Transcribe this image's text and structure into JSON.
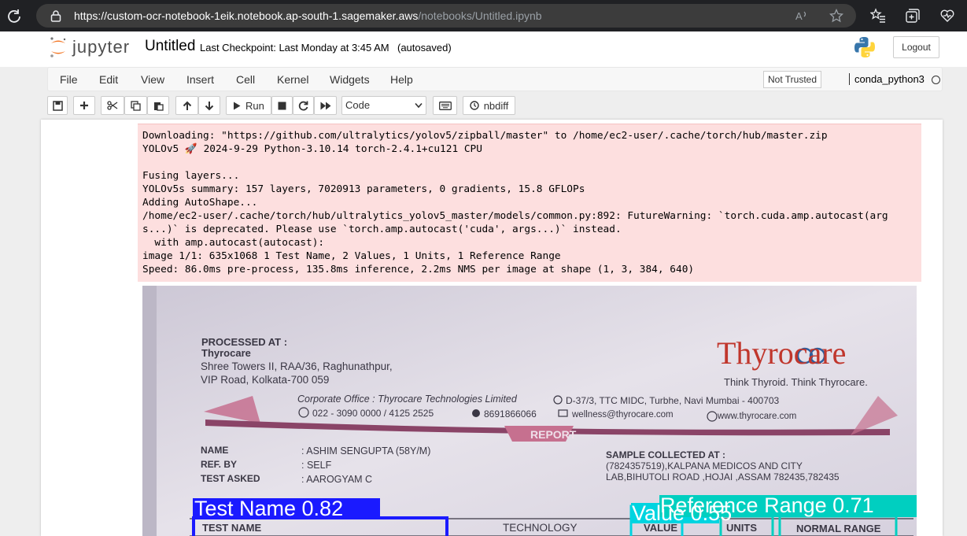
{
  "browser": {
    "url_host": "https://custom-ocr-notebook-1eik.notebook.ap-south-1.sagemaker.aws",
    "url_path": "/notebooks/Untitled.ipynb"
  },
  "header": {
    "wordmark": "jupyter",
    "notebook_title": "Untitled",
    "checkpoint": "Last Checkpoint: Last Monday at 3:45 AM",
    "autosaved": "(autosaved)",
    "logout_label": "Logout"
  },
  "menubar": {
    "items": [
      "File",
      "Edit",
      "View",
      "Insert",
      "Cell",
      "Kernel",
      "Widgets",
      "Help"
    ],
    "trust_status": "Not Trusted",
    "kernel": "conda_python3"
  },
  "toolbar": {
    "run_label": "Run",
    "cell_type": "Code",
    "nbdiff_label": "nbdiff"
  },
  "output": {
    "stderr_lines": [
      "Downloading: \"https://github.com/ultralytics/yolov5/zipball/master\" to /home/ec2-user/.cache/torch/hub/master.zip",
      "YOLOv5 🚀 2024-9-29 Python-3.10.14 torch-2.4.1+cu121 CPU",
      "",
      "Fusing layers...",
      "YOLOv5s summary: 157 layers, 7020913 parameters, 0 gradients, 15.8 GFLOPs",
      "Adding AutoShape...",
      "/home/ec2-user/.cache/torch/hub/ultralytics_yolov5_master/models/common.py:892: FutureWarning: `torch.cuda.amp.autocast(arg",
      "s...)` is deprecated. Please use `torch.amp.autocast('cuda', args...)` instead.",
      "  with amp.autocast(autocast):",
      "image 1/1: 635x1068 1 Test Name, 2 Values, 1 Units, 1 Reference Range",
      "Speed: 86.0ms pre-process, 135.8ms inference, 2.2ms NMS per image at shape (1, 3, 384, 640)"
    ]
  },
  "document": {
    "processed_at": "PROCESSED AT :",
    "lab_name": "Thyrocare",
    "address_1": "Shree Towers II, RAA/36, Raghunathpur,",
    "address_2": "VIP Road, Kolkata-700 059",
    "brand": "Thyrocare",
    "tagline": "Think Thyroid. Think Thyrocare.",
    "corporate_office": "Corporate Office : Thyrocare Technologies Limited",
    "corporate_address": "D-37/3, TTC MIDC, Turbhe, Navi Mumbai - 400703",
    "phone": "022 - 3090 0000 / 4125 2525",
    "whatsapp": "8691866066",
    "email": "wellness@thyrocare.com",
    "website": "www.thyrocare.com",
    "report_label": "REPORT",
    "name_label": "NAME",
    "name_value": ": ASHIM SENGUPTA (58Y/M)",
    "ref_label": "REF. BY",
    "ref_value": ": SELF",
    "test_asked_label": "TEST ASKED",
    "test_asked_value": ": AAROGYAM C",
    "sample_collected_label": "SAMPLE COLLECTED AT :",
    "sample_line_1": "(7824357519),KALPANA MEDICOS AND CITY",
    "sample_line_2": "LAB,BIHUTOLI ROAD ,HOJAI ,ASSAM 782435,782435",
    "col_test_name": "TEST NAME",
    "col_technology": "TECHNOLOGY",
    "col_value": "VALUE",
    "col_units": "UNITS",
    "col_normal_range": "NORMAL RANGE"
  },
  "detections": [
    {
      "label": "Test Name 0.82",
      "color": "#1a1aff"
    },
    {
      "label": "Value 0.55",
      "color": "#00d4e0"
    },
    {
      "label": "Reference Range 0.71",
      "color": "#00cfc0"
    }
  ],
  "colors": {
    "stderr_bg": "#fddfdf",
    "jupyter_orange": "#f37726"
  }
}
